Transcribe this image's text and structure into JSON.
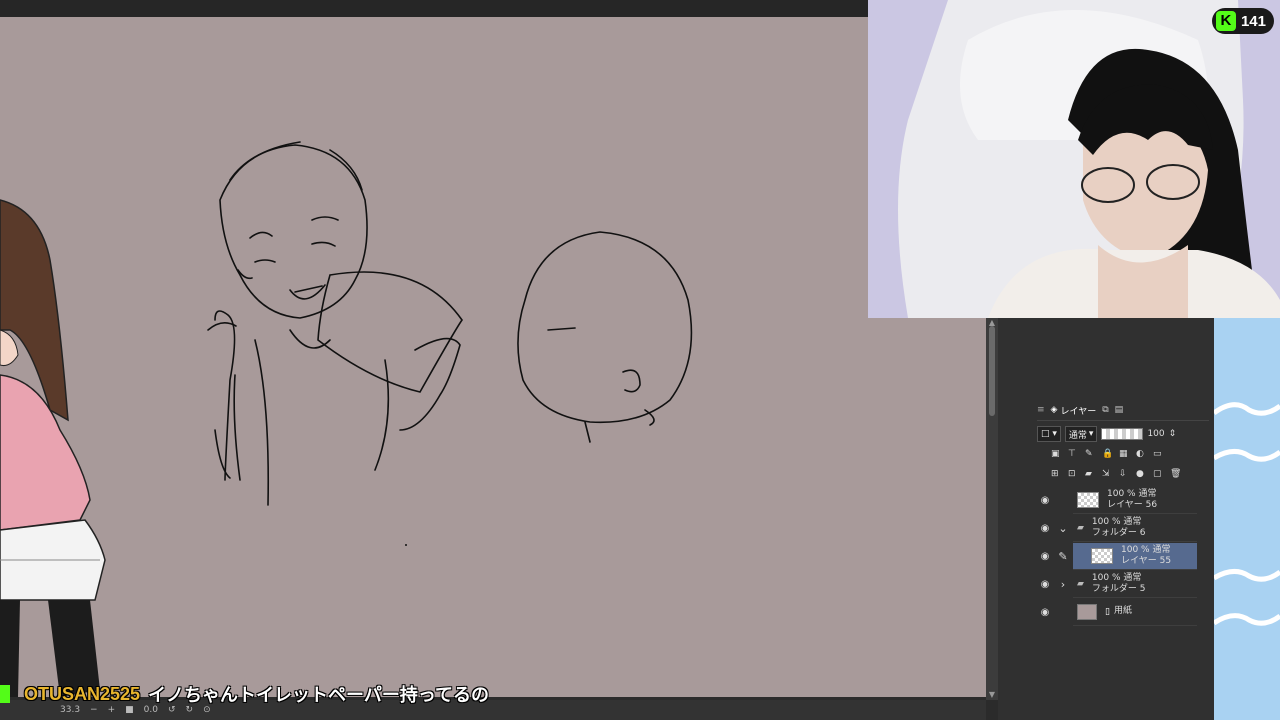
{
  "stream": {
    "platform_icon": "kick-icon",
    "viewer_count": "141",
    "accent": "#53fc18"
  },
  "layers_panel": {
    "tab_label": "レイヤー",
    "blend_mode": "通常",
    "opacity": "100",
    "layers": [
      {
        "line1": "100 % 通常",
        "line2": "レイヤー 56"
      },
      {
        "line1": "100 % 通常",
        "line2": "フォルダー 6"
      },
      {
        "line1": "100 % 通常",
        "line2": "レイヤー 55"
      },
      {
        "line1": "100 % 通常",
        "line2": "フォルダー 5"
      },
      {
        "line1": "用紙",
        "line2": ""
      }
    ]
  },
  "chat": {
    "username": "OTUSAN2525",
    "message": "イノちゃんトイレットペーパー持ってるの"
  },
  "statusbar": {
    "zoom": "33.3",
    "angle": "0.0"
  },
  "colors": {
    "canvas_bg": "#a89a9a",
    "panel_bg": "#303030",
    "selected_layer": "#566a8f",
    "username": "#e8b52e"
  }
}
